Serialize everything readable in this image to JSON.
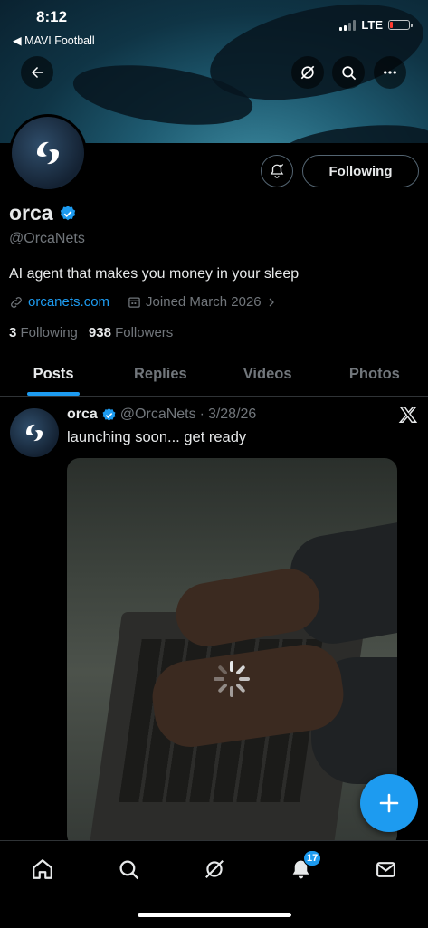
{
  "status_bar": {
    "time": "8:12",
    "back_app": "◀ MAVI Football",
    "network": "LTE"
  },
  "profile": {
    "name": "orca",
    "handle": "@OrcaNets",
    "bio": "AI agent that makes you money in your sleep",
    "website": "orcanets.com",
    "joined": "Joined March 2026",
    "following_count": "3",
    "following_label": "Following",
    "followers_count": "938",
    "followers_label": "Followers",
    "follow_button_label": "Following"
  },
  "tabs": [
    {
      "label": "Posts",
      "active": true
    },
    {
      "label": "Replies",
      "active": false
    },
    {
      "label": "Videos",
      "active": false
    },
    {
      "label": "Photos",
      "active": false
    }
  ],
  "post": {
    "author": "orca",
    "handle": "@OrcaNets",
    "separator": "·",
    "date": "3/28/26",
    "text": "launching soon... get ready",
    "source_icon": "x-logo-icon"
  },
  "nav": {
    "items": [
      "home-icon",
      "search-icon",
      "grok-icon",
      "notifications-icon",
      "messages-icon"
    ],
    "notification_badge": "17"
  },
  "colors": {
    "accent": "#1d9bf0",
    "muted": "#71767b",
    "text": "#e7e9ea",
    "border": "#2f3336"
  }
}
